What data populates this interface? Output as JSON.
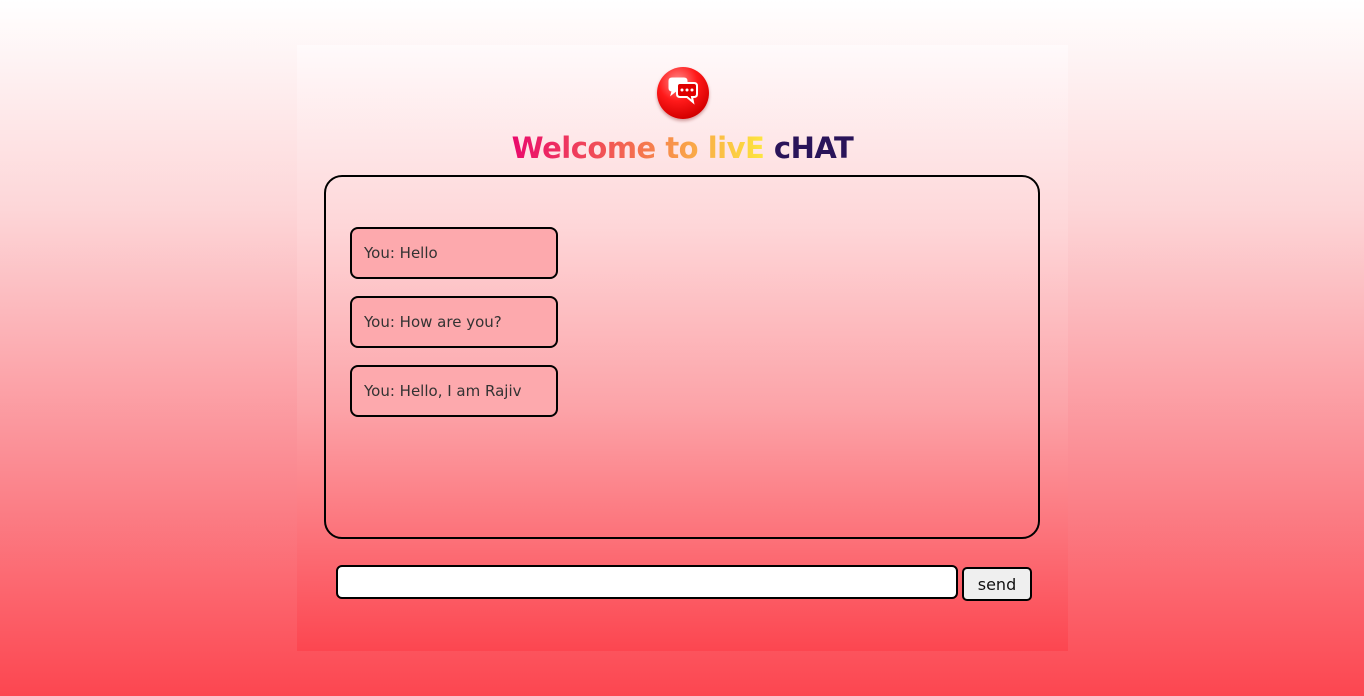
{
  "header": {
    "logo_icon": "chat-bubbles-icon",
    "title_part1": "Welcome to livE",
    "title_part2": "cHAT",
    "title_gradient_colors": [
      "#ea0a6c",
      "#f25a53",
      "#f9a348",
      "#fde63f"
    ],
    "title_dark_color": "#2a1459"
  },
  "chat": {
    "messages": [
      {
        "text": "You: Hello"
      },
      {
        "text": "You: How are you?"
      },
      {
        "text": "You: Hello, I am Rajiv"
      }
    ]
  },
  "composer": {
    "input_value": "",
    "send_label": "send"
  },
  "colors": {
    "background_top": "#ffffff",
    "background_bottom": "#fc4650",
    "message_bubble": "#fda9ad"
  }
}
